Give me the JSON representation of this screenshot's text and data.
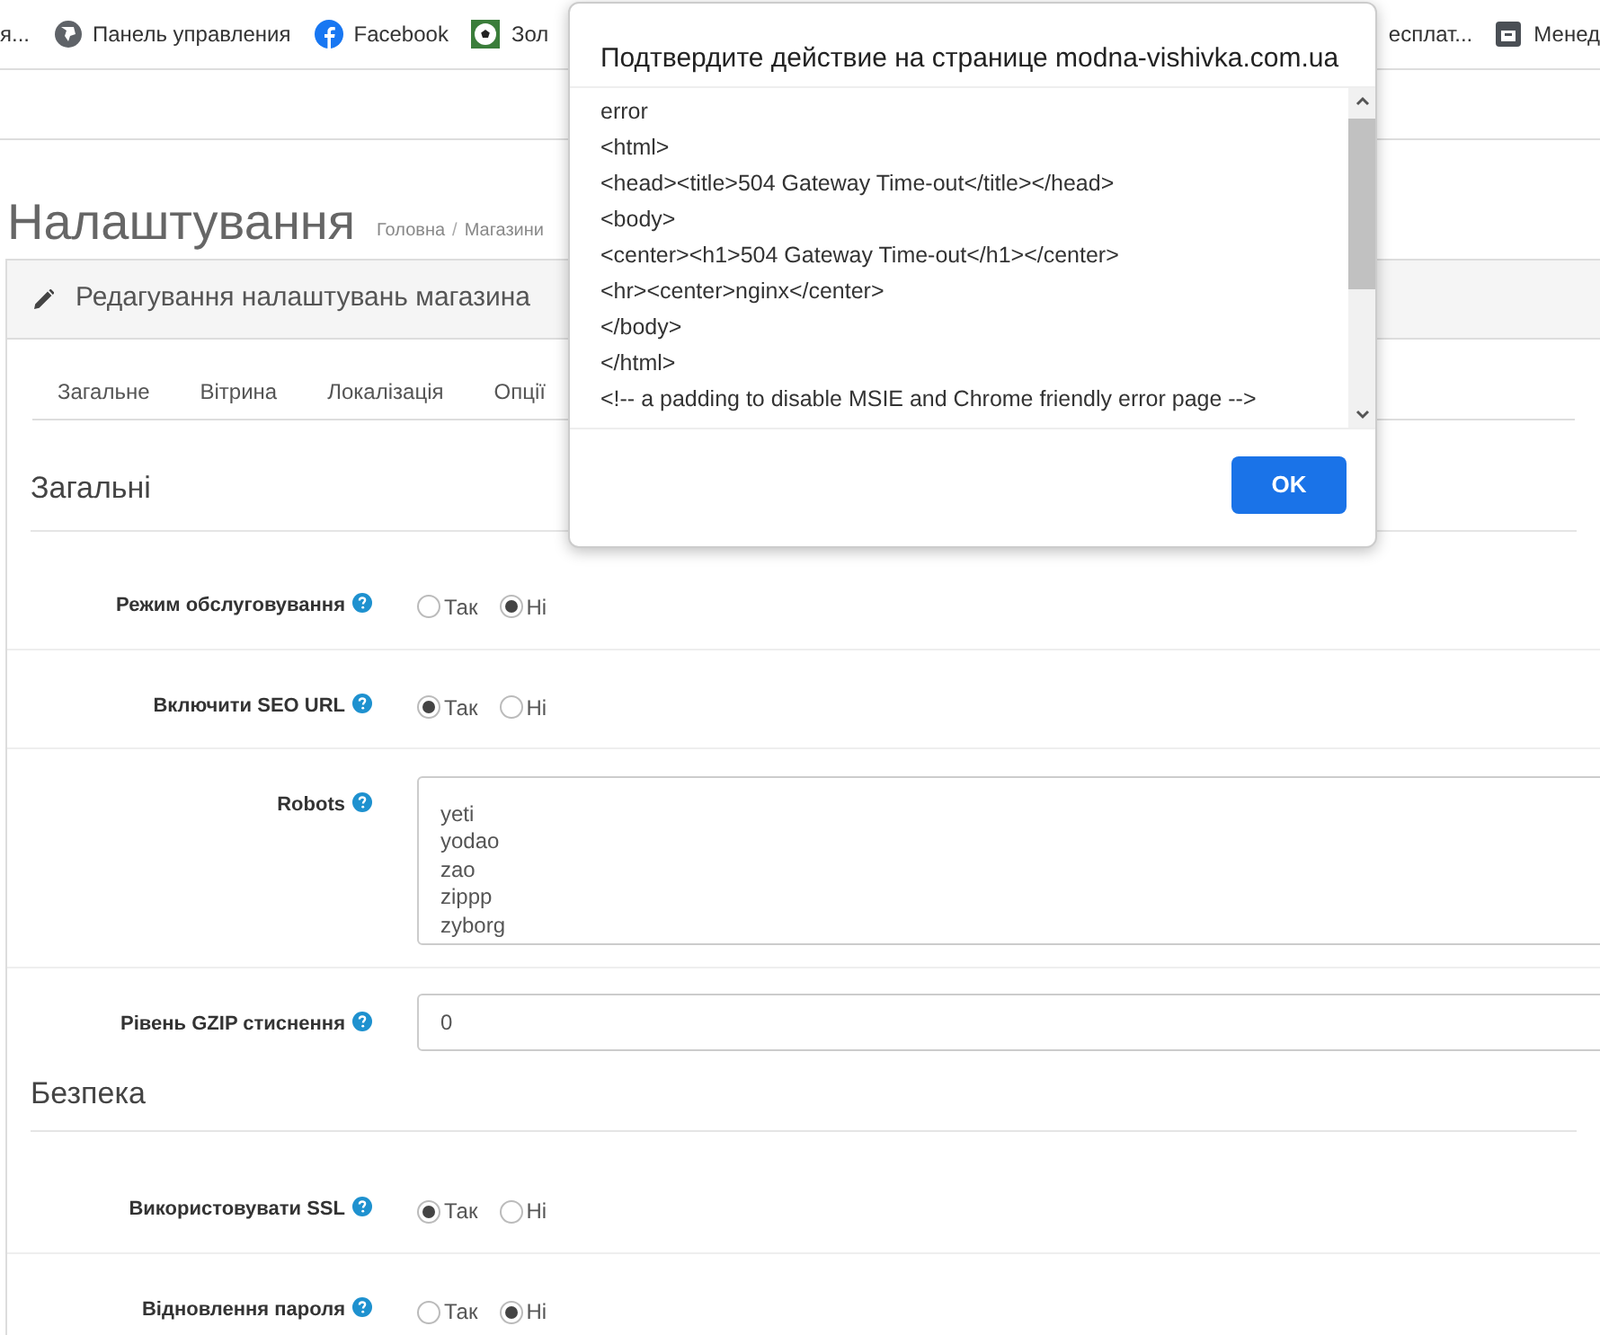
{
  "bookmarks": [
    {
      "label": "я..."
    },
    {
      "label": "Панель управления"
    },
    {
      "label": "Facebook"
    },
    {
      "label": "Зол"
    }
  ],
  "bookmarks_right": [
    {
      "label": "есплат..."
    },
    {
      "label": "Менед"
    }
  ],
  "breadcrumb_separator": "/",
  "page_title": "Налаштування",
  "breadcrumbs": [
    "Головна",
    "Магазини"
  ],
  "panel_title": "Редагування налаштувань магазина",
  "tabs": [
    {
      "label": "Загальне",
      "selected": false
    },
    {
      "label": "Вітрина",
      "selected": false
    },
    {
      "label": "Локалізація",
      "selected": false
    },
    {
      "label": "Опції",
      "selected": false
    }
  ],
  "sections": [
    {
      "title": "Загальні",
      "rows": [
        {
          "kind": "radio",
          "label": "Режим обслуговування",
          "options": [
            {
              "label": "Так",
              "selected": false
            },
            {
              "label": "Ні",
              "selected": true
            }
          ]
        },
        {
          "kind": "radio",
          "label": "Включити SEO URL",
          "options": [
            {
              "label": "Так",
              "selected": true
            },
            {
              "label": "Ні",
              "selected": false
            }
          ]
        },
        {
          "kind": "textarea",
          "label": "Robots",
          "lines": [
            "yeti",
            "yodao",
            "zao",
            "zippp",
            "zyborg"
          ]
        },
        {
          "kind": "input",
          "label": "Рівень GZIP стиснення",
          "value": "0"
        }
      ]
    },
    {
      "title": "Безпека",
      "rows": [
        {
          "kind": "radio",
          "label": "Використовувати SSL",
          "options": [
            {
              "label": "Так",
              "selected": true
            },
            {
              "label": "Ні",
              "selected": false
            }
          ]
        },
        {
          "kind": "radio",
          "label": "Відновлення пароля",
          "options": [
            {
              "label": "Так",
              "selected": false
            },
            {
              "label": "Ні",
              "selected": true
            }
          ]
        }
      ]
    }
  ],
  "dialog": {
    "title": "Подтвердите действие на странице modna-vishivka.com.ua",
    "lines": [
      "error",
      "<html>",
      "<head><title>504 Gateway Time-out</title></head>",
      "<body>",
      "<center><h1>504 Gateway Time-out</h1></center>",
      "<hr><center>nginx</center>",
      "</body>",
      "</html>",
      "<!-- a padding to disable MSIE and Chrome friendly error page -->"
    ],
    "button": "OK"
  }
}
